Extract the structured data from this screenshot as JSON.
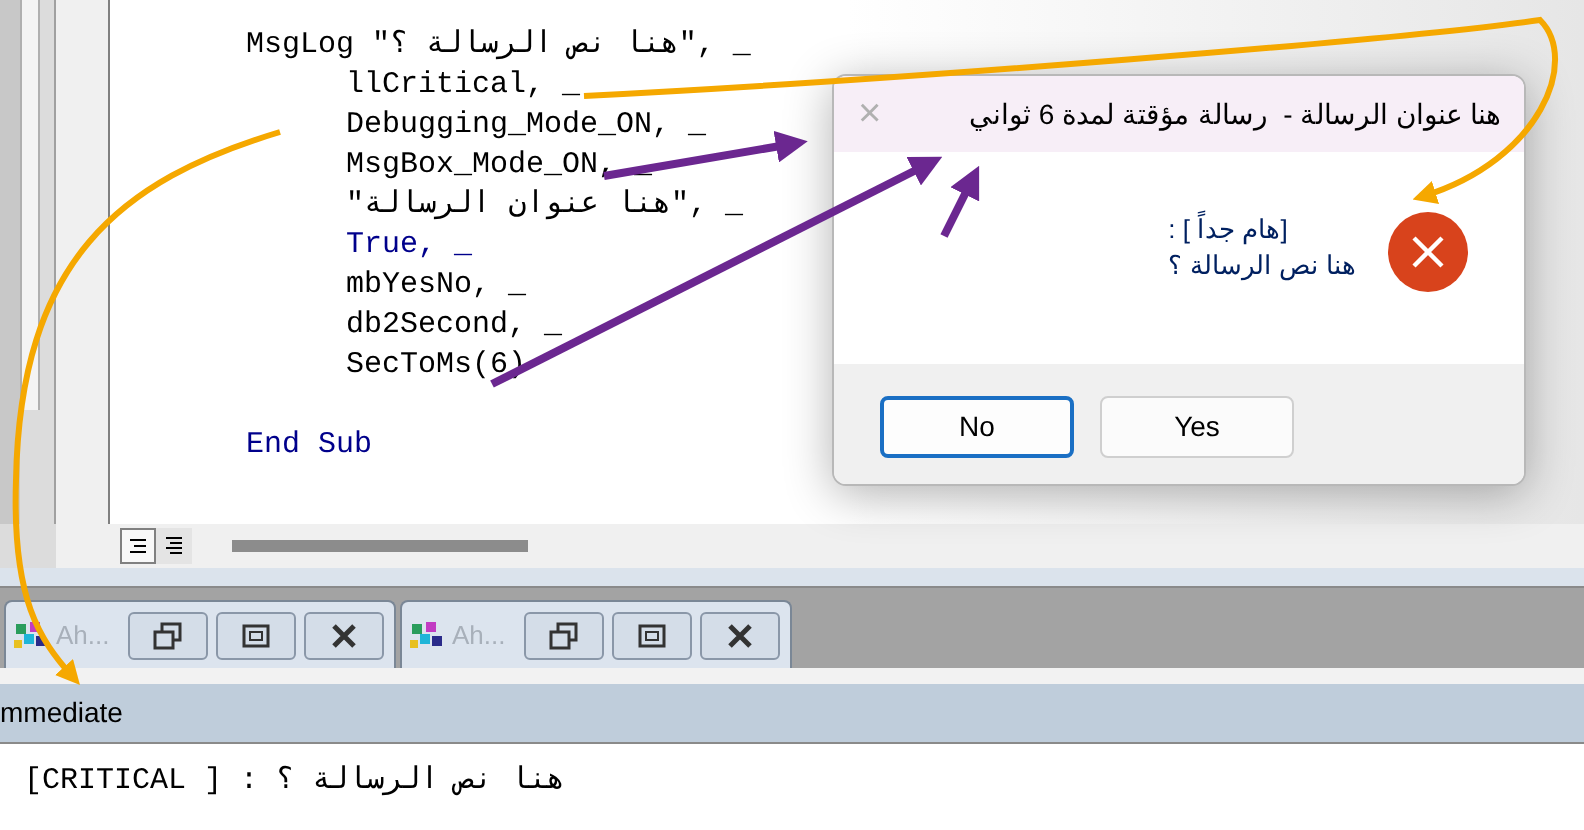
{
  "code": {
    "lines": [
      {
        "text": "MsgLog \"هنا نص الرسالة ؟\", _",
        "kind": "plain",
        "children": [
          {
            "text": "llCritical, _",
            "kind": "plain"
          },
          {
            "text": "Debugging_Mode_ON, _",
            "kind": "plain"
          },
          {
            "text": "MsgBox_Mode_ON, _",
            "kind": "plain"
          },
          {
            "text": "\"هنا عنوان الرسالة\", _",
            "kind": "plain"
          },
          {
            "text": "True, _",
            "kind": "keyword"
          },
          {
            "text": "mbYesNo, _",
            "kind": "plain"
          },
          {
            "text": "db2Second, _",
            "kind": "plain"
          },
          {
            "text": "SecToMs(6)",
            "kind": "plain"
          }
        ]
      },
      {
        "kind": "blank"
      },
      {
        "text": "End Sub",
        "kind": "keyword"
      }
    ]
  },
  "minimized_windows": [
    {
      "title": "Ah..."
    },
    {
      "title": "Ah..."
    }
  ],
  "immediate": {
    "title": "mmediate",
    "output": "[CRITICAL ] : هنا نص الرسالة ؟"
  },
  "dialog": {
    "title": "هنا عنوان الرسالة -  رسالة مؤقتة لمدة 6 ثواني",
    "close": "×",
    "message_lines": [
      "[هام جداً ] :",
      "هنا نص الرسالة ؟"
    ],
    "buttons": [
      {
        "label": "Yes",
        "selected": false
      },
      {
        "label": "No",
        "selected": true
      }
    ]
  }
}
